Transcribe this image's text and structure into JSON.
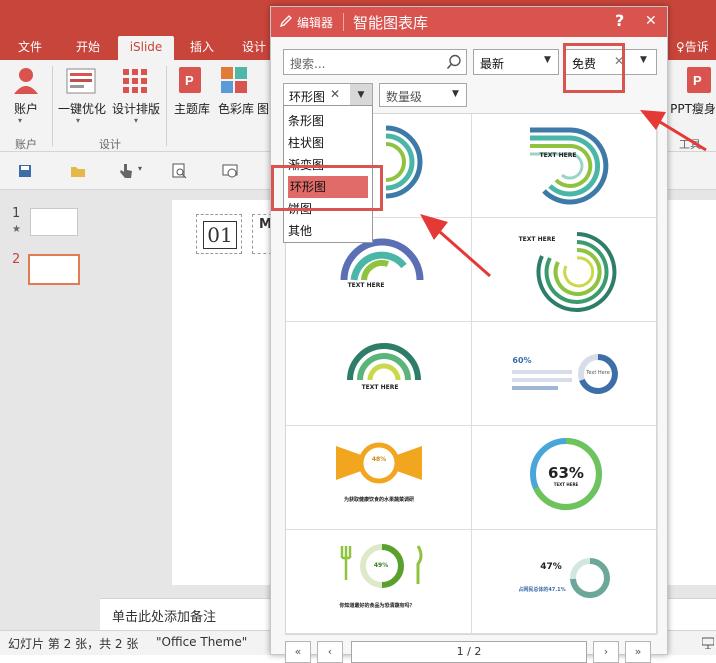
{
  "ribbon_tabs": [
    "文件",
    "开始",
    "iSlide",
    "插入",
    "设计"
  ],
  "tell_me": "告诉",
  "ribbon": {
    "account_btn": "账户",
    "account_group": "账户",
    "optimize_btn": "一键优化",
    "layout_btn": "设计排版",
    "design_group": "设计",
    "theme_btn": "主题库",
    "color_btn": "色彩库",
    "trunc_btn": "图",
    "ppt_btn": "PPT瘦身",
    "tools_group": "工具"
  },
  "slides": [
    {
      "num": "1",
      "star": "★"
    },
    {
      "num": "2",
      "star": ""
    }
  ],
  "slide_content": {
    "number": "01",
    "letter": "M"
  },
  "notes_placeholder": "单击此处添加备注",
  "status": {
    "slide_info": "幻灯片 第 2 张，共 2 张",
    "theme": "\"Office Theme\""
  },
  "dialog": {
    "editor": "编辑器",
    "title": "智能图表库",
    "help": "?",
    "close": "✕",
    "search_placeholder": "搜索...",
    "sort_value": "最新",
    "price_value": "免费",
    "category_value": "环形图",
    "count_placeholder": "数量级",
    "category_options": [
      "条形图",
      "柱状图",
      "渐变图",
      "环形图",
      "饼图",
      "其他"
    ],
    "page_info": "1 / 2"
  },
  "charts": {
    "text_here": "TEXT HERE",
    "pct1": "60%",
    "text_here2": "Text Here",
    "pct2": "48%",
    "cap2": "为获取健康饮食的水果蔬菜调研",
    "pct3": "63%",
    "pct4": "49%",
    "cap4": "你知道最好的食品为恐清蔬有吗？",
    "pct5": "47%",
    "cap5": "占网民总体的47.1%"
  },
  "colors": {
    "accent": "#c8453b",
    "dialog_title": "#d9534f",
    "highlight": "#d9534f",
    "arrow": "#e53935"
  }
}
